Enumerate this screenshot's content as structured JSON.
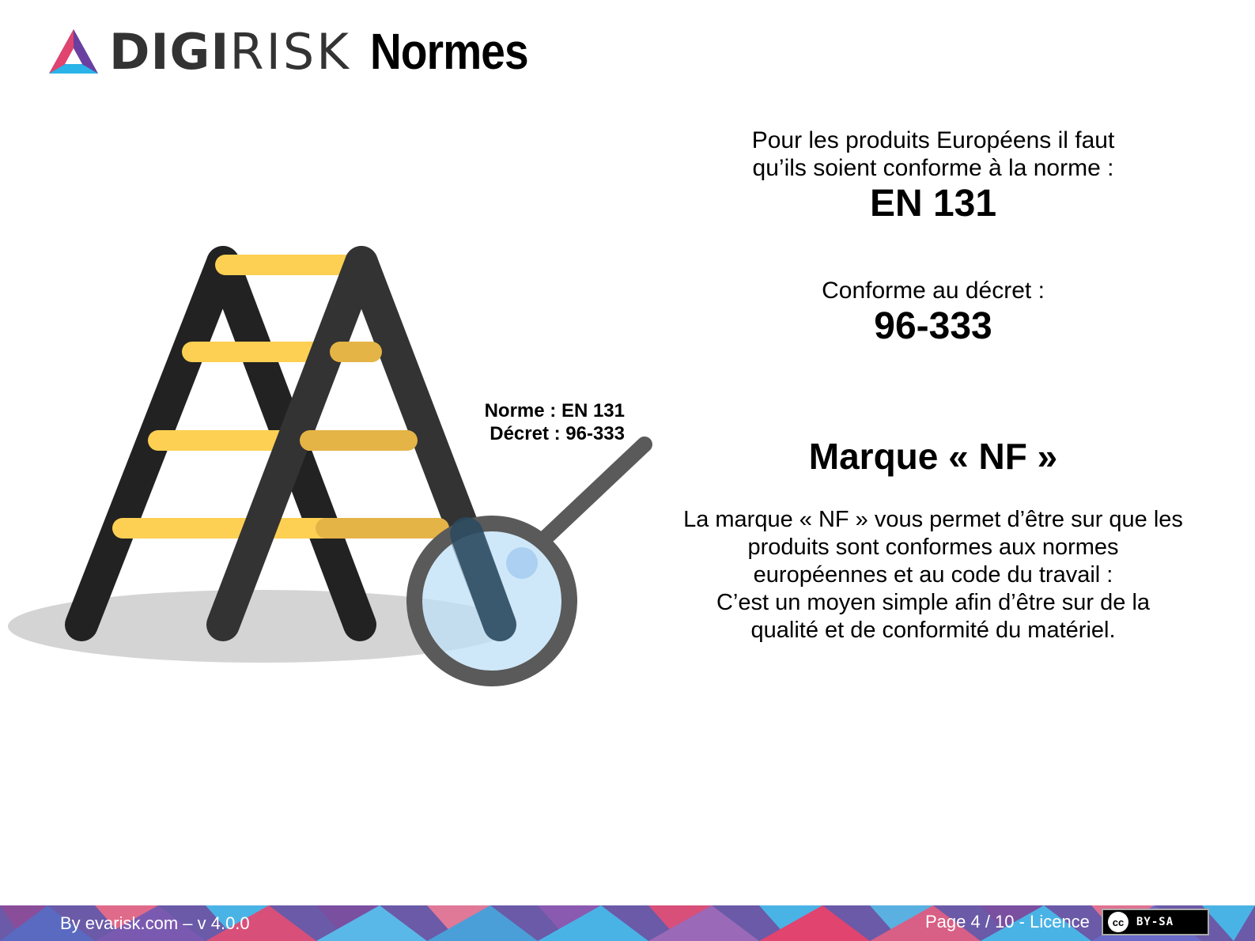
{
  "header": {
    "logo_strong": "DIGI",
    "logo_light": "RISK",
    "title": "Normes"
  },
  "illustration": {
    "label_line1": "Norme : EN 131",
    "label_line2": "Décret : 96-333"
  },
  "content": {
    "intro_line1": "Pour les produits Européens il faut",
    "intro_line2": "qu’ils soient conforme à la norme :",
    "norme_code": "EN 131",
    "decret_intro": "Conforme au décret :",
    "decret_code": "96-333",
    "nf_title": "Marque « NF »",
    "nf_body_lines": [
      "La marque « NF » vous permet d’être sur que les",
      "produits sont conformes aux normes",
      "européennes et au code du travail :",
      "C’est un moyen simple afin d’être sur de la",
      "qualité et de conformité du matériel."
    ]
  },
  "footer": {
    "credit": "By evarisk.com – v 4.0.0",
    "page": "Page 4 / 10 - Licence",
    "license_badge_symbol": "cc",
    "license_badge_text": "BY-SA"
  },
  "colors": {
    "ladder_dark": "#222222",
    "ladder_dark_front": "#333333",
    "rung_yellow": "#fdd053",
    "rung_yellow_shade": "#e5b446",
    "lens_fill": "#bfe0f7",
    "footer_blue": "#4ab3e6",
    "footer_pink": "#d84f7a",
    "footer_purple": "#7a4fa0"
  }
}
